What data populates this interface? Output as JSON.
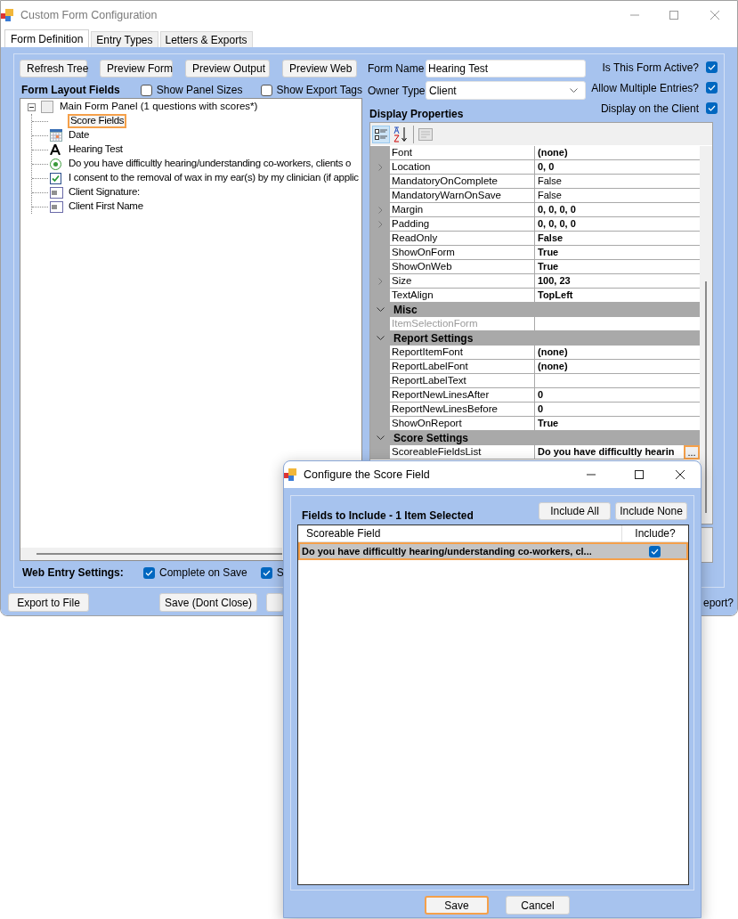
{
  "window": {
    "title": "Custom Form Configuration"
  },
  "tabs": [
    {
      "label": "Form Definition",
      "selected": true
    },
    {
      "label": "Entry Types",
      "selected": false
    },
    {
      "label": "Letters & Exports",
      "selected": false
    }
  ],
  "toolbar_buttons": [
    "Refresh Tree",
    "Preview Form",
    "Preview Output",
    "Preview Web"
  ],
  "layout_fields": {
    "label": "Form Layout Fields",
    "options": [
      {
        "label": "Show Panel Sizes",
        "checked": false
      },
      {
        "label": "Show Export Tags",
        "checked": false
      }
    ]
  },
  "tree": [
    {
      "kind": "panel",
      "label": "Main Form Panel (1 questions with scores*)",
      "expanded": true,
      "selected": false,
      "children": [
        {
          "kind": "plain",
          "label": "Score Fields",
          "selected": true
        },
        {
          "kind": "date",
          "label": "Date",
          "selected": false
        },
        {
          "kind": "text",
          "label": "Hearing Test",
          "selected": false
        },
        {
          "kind": "radio",
          "label": "Do you have difficultly hearing/understanding co-workers, clients o",
          "selected": false
        },
        {
          "kind": "checkbox",
          "label": "I consent to the removal of wax in my ear(s) by my clinician (if applic",
          "selected": false
        },
        {
          "kind": "textbox",
          "label": "Client Signature:",
          "selected": false
        },
        {
          "kind": "textbox",
          "label": "Client First Name",
          "selected": false
        }
      ]
    }
  ],
  "web_entry": {
    "label": "Web Entry Settings:",
    "options": [
      {
        "label": "Complete on Save",
        "checked": true
      },
      {
        "label": "S",
        "checked": true
      }
    ]
  },
  "form": {
    "name_label": "Form Name",
    "name_value": "Hearing Test",
    "owner_label": "Owner Type",
    "owner_value": "Client"
  },
  "flags": [
    {
      "label": "Is This Form Active?",
      "checked": true
    },
    {
      "label": "Allow Multiple Entries?",
      "checked": true
    },
    {
      "label": "Display on the Client",
      "checked": true
    }
  ],
  "display_properties": {
    "label": "Display Properties",
    "rows": [
      {
        "kind": "property",
        "name": "Font",
        "value": "(none)",
        "bold": true,
        "expandable": false,
        "disabled": false
      },
      {
        "kind": "property",
        "name": "Location",
        "value": "0, 0",
        "bold": true,
        "expandable": true,
        "disabled": false
      },
      {
        "kind": "property",
        "name": "MandatoryOnComplete",
        "value": "False",
        "bold": false,
        "expandable": false,
        "disabled": false
      },
      {
        "kind": "property",
        "name": "MandatoryWarnOnSave",
        "value": "False",
        "bold": false,
        "expandable": false,
        "disabled": false
      },
      {
        "kind": "property",
        "name": "Margin",
        "value": "0, 0, 0, 0",
        "bold": true,
        "expandable": true,
        "disabled": false
      },
      {
        "kind": "property",
        "name": "Padding",
        "value": "0, 0, 0, 0",
        "bold": true,
        "expandable": true,
        "disabled": false
      },
      {
        "kind": "property",
        "name": "ReadOnly",
        "value": "False",
        "bold": true,
        "expandable": false,
        "disabled": false
      },
      {
        "kind": "property",
        "name": "ShowOnForm",
        "value": "True",
        "bold": true,
        "expandable": false,
        "disabled": false
      },
      {
        "kind": "property",
        "name": "ShowOnWeb",
        "value": "True",
        "bold": true,
        "expandable": false,
        "disabled": false
      },
      {
        "kind": "property",
        "name": "Size",
        "value": "100, 23",
        "bold": true,
        "expandable": true,
        "disabled": false
      },
      {
        "kind": "property",
        "name": "TextAlign",
        "value": "TopLeft",
        "bold": true,
        "expandable": false,
        "disabled": false
      },
      {
        "kind": "category",
        "name": "Misc",
        "expanded": true
      },
      {
        "kind": "property",
        "name": "ItemSelectionForm",
        "expandable": false,
        "disabled": true
      },
      {
        "kind": "category",
        "name": "Report Settings",
        "expanded": true
      },
      {
        "kind": "property",
        "name": "ReportItemFont",
        "value": "(none)",
        "bold": true,
        "expandable": false,
        "disabled": false
      },
      {
        "kind": "property",
        "name": "ReportLabelFont",
        "value": "(none)",
        "bold": true,
        "expandable": false,
        "disabled": false
      },
      {
        "kind": "property",
        "name": "ReportLabelText",
        "expandable": false,
        "disabled": false
      },
      {
        "kind": "property",
        "name": "ReportNewLinesAfter",
        "value": "0",
        "bold": true,
        "expandable": false,
        "disabled": false
      },
      {
        "kind": "property",
        "name": "ReportNewLinesBefore",
        "value": "0",
        "bold": true,
        "expandable": false,
        "disabled": false
      },
      {
        "kind": "property",
        "name": "ShowOnReport",
        "value": "True",
        "bold": true,
        "expandable": false,
        "disabled": false
      },
      {
        "kind": "category",
        "name": "Score Settings",
        "expanded": true
      },
      {
        "kind": "property",
        "name": "ScoreableFieldsList",
        "value": "Do you have difficultly hearin",
        "bold": true,
        "expandable": false,
        "disabled": false,
        "button": {
          "label": "...",
          "focused": true
        }
      }
    ]
  },
  "bottom_bar": {
    "buttons": [
      "Export to File",
      "Save (Dont Close)"
    ],
    "report_label": "eport?"
  },
  "dialog": {
    "title": "Configure the Score Field",
    "heading": "Fields to Include - 1 Item Selected",
    "buttons": [
      "Include All",
      "Include None"
    ],
    "columns": [
      "Scoreable Field",
      "Include?"
    ],
    "rows": [
      {
        "field": "Do you have difficultly hearing/understanding co-workers, cl...",
        "include": true,
        "selected": true
      }
    ],
    "actions": [
      {
        "label": "Save",
        "focused": true
      },
      {
        "label": "Cancel",
        "focused": false
      }
    ]
  }
}
